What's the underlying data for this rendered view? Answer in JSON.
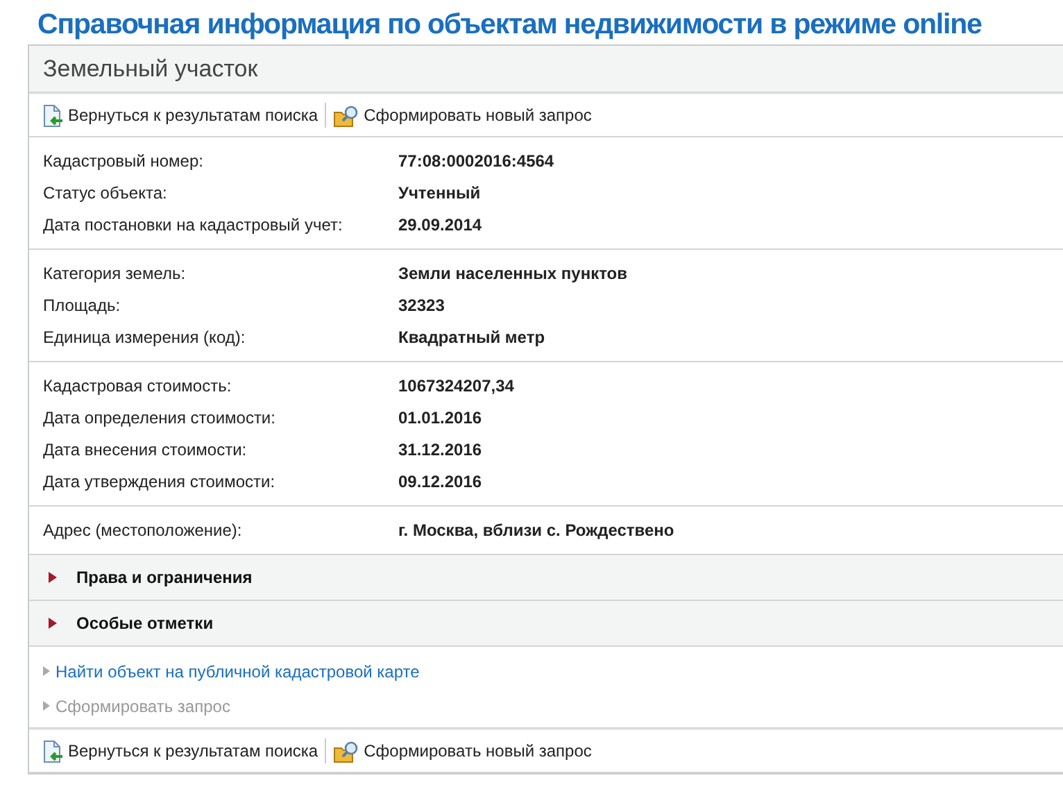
{
  "page_title": "Справочная информация по объектам недвижимости в режиме online",
  "panel": {
    "title": "Земельный участок",
    "top_toolbar": [
      {
        "kind": "back",
        "label": "Вернуться к результатам поиска"
      },
      {
        "kind": "query",
        "label": "Сформировать новый запрос"
      }
    ],
    "groups": [
      [
        {
          "label": "Кадастровый номер:",
          "value": "77:08:0002016:4564"
        },
        {
          "label": "Статус объекта:",
          "value": "Учтенный"
        },
        {
          "label": "Дата постановки на кадастровый учет:",
          "value": "29.09.2014"
        }
      ],
      [
        {
          "label": "Категория земель:",
          "value": "Земли населенных пунктов"
        },
        {
          "label": "Площадь:",
          "value": "32323"
        },
        {
          "label": "Единица измерения (код):",
          "value": "Квадратный метр"
        }
      ],
      [
        {
          "label": "Кадастровая стоимость:",
          "value": "1067324207,34"
        },
        {
          "label": "Дата определения стоимости:",
          "value": "01.01.2016"
        },
        {
          "label": "Дата внесения стоимости:",
          "value": "31.12.2016"
        },
        {
          "label": "Дата утверждения стоимости:",
          "value": "09.12.2016"
        }
      ],
      [
        {
          "label": "Адрес (местоположение):",
          "value": "г. Москва, вблизи с. Рождествено"
        }
      ]
    ],
    "sections": [
      {
        "label": "Права и ограничения",
        "expanded": false
      },
      {
        "label": "Особые отметки",
        "expanded": false
      }
    ],
    "links": [
      {
        "label": "Найти объект на публичной кадастровой карте",
        "disabled": false
      },
      {
        "label": "Сформировать запрос",
        "disabled": true
      }
    ],
    "bottom_toolbar": [
      {
        "kind": "back",
        "label": "Вернуться к результатам поиска"
      },
      {
        "kind": "query",
        "label": "Сформировать новый запрос"
      }
    ]
  }
}
